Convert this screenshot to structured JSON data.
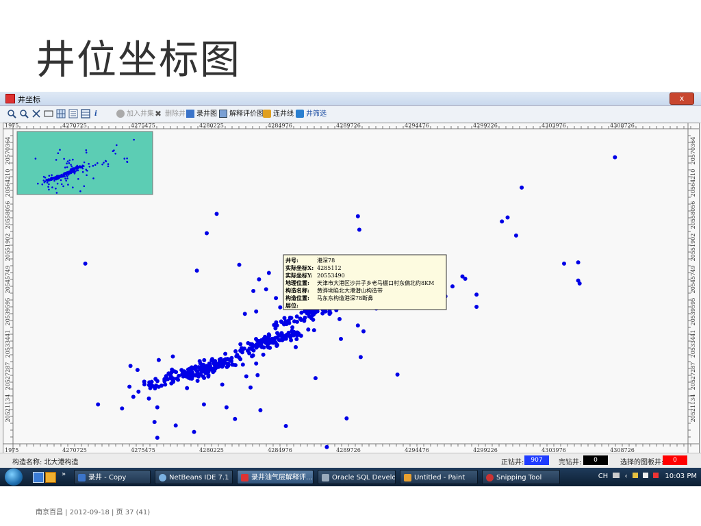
{
  "slide": {
    "title": "井位坐标图",
    "footer": "南京百昌 | 2012-09-18 | 页 37 (41)"
  },
  "window": {
    "title": "井坐标",
    "close_label": "x"
  },
  "toolbar": {
    "add_well": "加入井集",
    "delete_well": "删除井",
    "log_chart": "录井图",
    "interpretation_chart": "解释评价图",
    "connect_line": "连井线",
    "well_filter": "井筛选"
  },
  "axes": {
    "x_ticks": [
      "4275475",
      "4280225",
      "4284976",
      "4289726",
      "4294476",
      "4299226",
      "4303976",
      "4308726"
    ],
    "x_tick_first": "4270725",
    "x_edge_label": "1975",
    "y_ticks": [
      "20570364",
      "20564210",
      "20558056",
      "20551902",
      "20545749",
      "20539595",
      "20533441",
      "20527287",
      "20521134"
    ]
  },
  "tooltip": {
    "well_no_label": "井号:",
    "well_no": "港深78",
    "x_label": "实际坐标X:",
    "x_value": "4285112",
    "y_label": "实际坐标Y:",
    "y_value": "20553490",
    "location_label": "地理位置:",
    "location_value": "天津市大港区沙井子乡老马棚口村东偏北约8KM",
    "structure_name_label": "构造名称:",
    "structure_name_value": "黄骅坳陷北大港潜山构造带",
    "structure_pos_label": "构造位置:",
    "structure_pos_value": "马东东构造港深78断鼻",
    "layer_label": "层位:"
  },
  "status": {
    "structure_label": "构造名称: 北大港构造",
    "drilling_label": "正钻井:",
    "drilling_count": "907",
    "completed_label": "完钻井:",
    "completed_count": "0",
    "selected_label": "选择的图板井:",
    "selected_count": "0"
  },
  "taskbar": {
    "items": [
      {
        "label": "录井 - Copy"
      },
      {
        "label": "NetBeans IDE 7.1"
      },
      {
        "label": "录井油气层解释评..."
      },
      {
        "label": "Oracle SQL Develop..."
      },
      {
        "label": "Untitled - Paint"
      },
      {
        "label": "Snipping Tool"
      }
    ],
    "lang": "CH",
    "time": "10:03 PM"
  },
  "colors": {
    "point": "#0000e6",
    "minimap": "#5ccdb4",
    "drilling_box": "#1f3cff",
    "completed_box": "#000000",
    "selected_box": "#ff0000"
  },
  "chart_data": {
    "type": "scatter",
    "xlim": [
      4270725,
      4308726
    ],
    "ylim": [
      20521134,
      20570364
    ],
    "x_step": 4750.25,
    "y_step": 6154,
    "clusters": [
      {
        "x": 4279500,
        "y": 20531500,
        "count": 140
      },
      {
        "x": 4283800,
        "y": 20536000,
        "count": 120
      },
      {
        "x": 4286500,
        "y": 20540500,
        "count": 60
      },
      {
        "x": 4277000,
        "y": 20530000,
        "count": 40
      }
    ],
    "points": [
      [
        4308400,
        20567600
      ],
      [
        4301800,
        20562400
      ],
      [
        4300800,
        20557300
      ],
      [
        4300400,
        20556600
      ],
      [
        4301400,
        20554200
      ],
      [
        4304800,
        20549400
      ],
      [
        4305800,
        20549600
      ],
      [
        4305800,
        20546500
      ],
      [
        4305900,
        20546000
      ],
      [
        4290200,
        20557500
      ],
      [
        4290300,
        20555200
      ],
      [
        4280200,
        20557900
      ],
      [
        4279500,
        20554600
      ],
      [
        4278800,
        20548200
      ],
      [
        4281800,
        20549200
      ],
      [
        4285100,
        20548400
      ],
      [
        4283900,
        20547800
      ],
      [
        4290200,
        20538800
      ],
      [
        4288900,
        20539900
      ],
      [
        4291500,
        20541700
      ],
      [
        4293700,
        20543400
      ],
      [
        4294500,
        20545000
      ],
      [
        4296900,
        20545500
      ],
      [
        4297600,
        20547200
      ],
      [
        4297800,
        20546800
      ],
      [
        4298600,
        20544100
      ],
      [
        4298600,
        20542000
      ],
      [
        4296400,
        20543800
      ],
      [
        4288200,
        20541300
      ],
      [
        4283000,
        20541200
      ],
      [
        4282200,
        20540800
      ],
      [
        4285000,
        20540100
      ],
      [
        4284400,
        20543500
      ],
      [
        4283700,
        20545000
      ],
      [
        4283200,
        20546700
      ],
      [
        4282800,
        20544700
      ],
      [
        4284700,
        20541900
      ],
      [
        4285700,
        20539500
      ],
      [
        4286800,
        20542600
      ],
      [
        4287100,
        20538000
      ],
      [
        4286400,
        20539600
      ],
      [
        4289000,
        20536500
      ],
      [
        4290600,
        20537800
      ],
      [
        4289500,
        20545800
      ],
      [
        4292800,
        20542400
      ],
      [
        4291200,
        20544400
      ],
      [
        4270900,
        20549400
      ],
      [
        4271800,
        20525300
      ],
      [
        4276000,
        20524800
      ],
      [
        4275800,
        20522300
      ],
      [
        4275400,
        20526300
      ],
      [
        4274300,
        20526600
      ],
      [
        4273500,
        20524600
      ],
      [
        4280900,
        20524800
      ],
      [
        4281500,
        20522800
      ],
      [
        4278600,
        20520600
      ],
      [
        4277300,
        20521700
      ],
      [
        4283100,
        20530300
      ],
      [
        4285100,
        20521600
      ],
      [
        4283300,
        20524300
      ],
      [
        4288000,
        20518000
      ],
      [
        4289400,
        20522900
      ],
      [
        4293000,
        20530400
      ],
      [
        4279000,
        20516500
      ],
      [
        4276000,
        20519600
      ],
      [
        4276800,
        20530600
      ],
      [
        4274600,
        20531200
      ],
      [
        4276100,
        20532900
      ],
      [
        4277100,
        20533500
      ],
      [
        4275500,
        20528100
      ],
      [
        4274100,
        20531900
      ],
      [
        4278100,
        20528100
      ],
      [
        4279300,
        20525300
      ],
      [
        4278300,
        20531400
      ],
      [
        4280600,
        20528700
      ],
      [
        4283500,
        20533800
      ],
      [
        4287200,
        20529800
      ],
      [
        4285800,
        20535100
      ],
      [
        4290400,
        20533400
      ],
      [
        4279000,
        20532700
      ],
      [
        4281200,
        20532800
      ],
      [
        4283000,
        20532300
      ],
      [
        4282300,
        20530100
      ],
      [
        4280700,
        20532300
      ],
      [
        4282600,
        20528200
      ]
    ]
  }
}
